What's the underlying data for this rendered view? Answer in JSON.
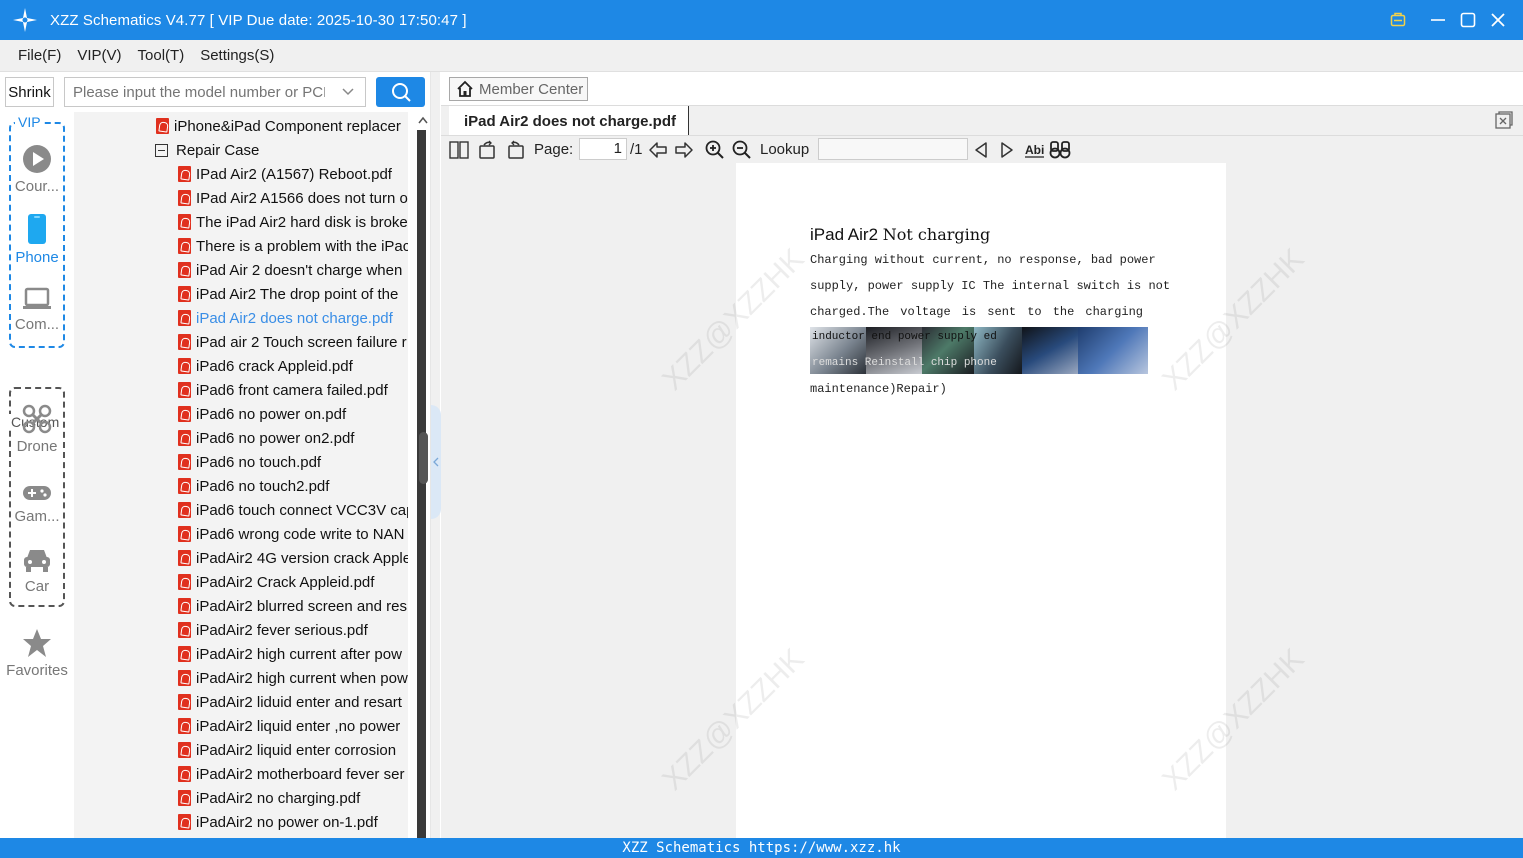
{
  "window": {
    "title": "XZZ Schematics V4.77 [ VIP Due date: 2025-10-30 17:50:47 ]",
    "controls": [
      "badge-icon",
      "minimize-icon",
      "maximize-icon",
      "close-icon"
    ]
  },
  "menu": {
    "items": [
      "File(F)",
      "VIP(V)",
      "Tool(T)",
      "Settings(S)"
    ]
  },
  "left": {
    "shrink_label": "Shrink",
    "search_placeholder": "Please input the model number or PCB",
    "vip_label": "VIP",
    "rail": [
      {
        "label": "Cour...",
        "icon": "play-circle-icon"
      },
      {
        "label": "Phone",
        "icon": "phone-icon",
        "active": true
      },
      {
        "label": "Com...",
        "icon": "laptop-icon"
      }
    ],
    "custom_label": "Custom",
    "custom_rail": [
      {
        "label": "Drone",
        "icon": "drone-icon"
      },
      {
        "label": "Gam...",
        "icon": "gamepad-icon"
      },
      {
        "label": "Car",
        "icon": "car-icon"
      }
    ],
    "favorites_label": "Favorites"
  },
  "tree": {
    "parent_file": "iPhone&iPad Component replacer",
    "folder": "Repair Case",
    "files": [
      "IPad Air2 (A1567) Reboot.pdf",
      "IPad Air2 A1566 does not turn o",
      "The iPad Air2 hard disk is broke",
      "There is a problem with the iPac",
      "iPad Air 2 doesn't charge when",
      "iPad Air2 The drop point of the",
      "iPad Air2 does not charge.pdf",
      "iPad air 2 Touch screen failure r",
      "iPad6 crack Appleid.pdf",
      "iPad6 front camera failed.pdf",
      "iPad6 no power on.pdf",
      "iPad6 no power on2.pdf",
      "iPad6 no touch.pdf",
      "iPad6 no touch2.pdf",
      "iPad6 touch connect VCC3V cap",
      "iPad6 wrong code write to NAN",
      "iPadAir2 4G version crack Apple",
      "iPadAir2 Crack Appleid.pdf",
      "iPadAir2 blurred screen and res",
      "iPadAir2 fever serious.pdf",
      "iPadAir2 high current after pow",
      "iPadAir2 high current when pow",
      "iPadAir2 liduid enter and resart",
      "iPadAir2 liquid enter ,no power",
      "iPadAir2 liquid enter corrosion",
      "iPadAir2 motherboard fever ser",
      "iPadAir2 no charging.pdf",
      "iPadAir2 no power on-1.pdf"
    ],
    "selected_index": 6
  },
  "viewer": {
    "member_center": "Member Center",
    "tab_title": "iPad Air2 does not charge.pdf",
    "page_label": "Page:",
    "page_value": "1",
    "page_total": "/1",
    "lookup_label": "Lookup",
    "lookup_value": "",
    "doc": {
      "title_a": "iPad Air2",
      "title_b": "Not charging",
      "lines": [
        "Charging without current, no response, bad power",
        "supply, power supply IC The internal switch is not",
        "charged.The voltage is sent to the charging"
      ],
      "strip_line1": "inductor end      power supply      ed",
      "strip_line2": "remains   Reinstall   chip      phone",
      "last_line": "maintenance)Repair)"
    },
    "watermark": "XZZ@XZZHK"
  },
  "status": {
    "text": "XZZ Schematics https://www.xzz.hk"
  },
  "colors": {
    "accent": "#1e88e5",
    "pdf_red": "#e0301e",
    "selected_text": "#3a8ee6"
  }
}
